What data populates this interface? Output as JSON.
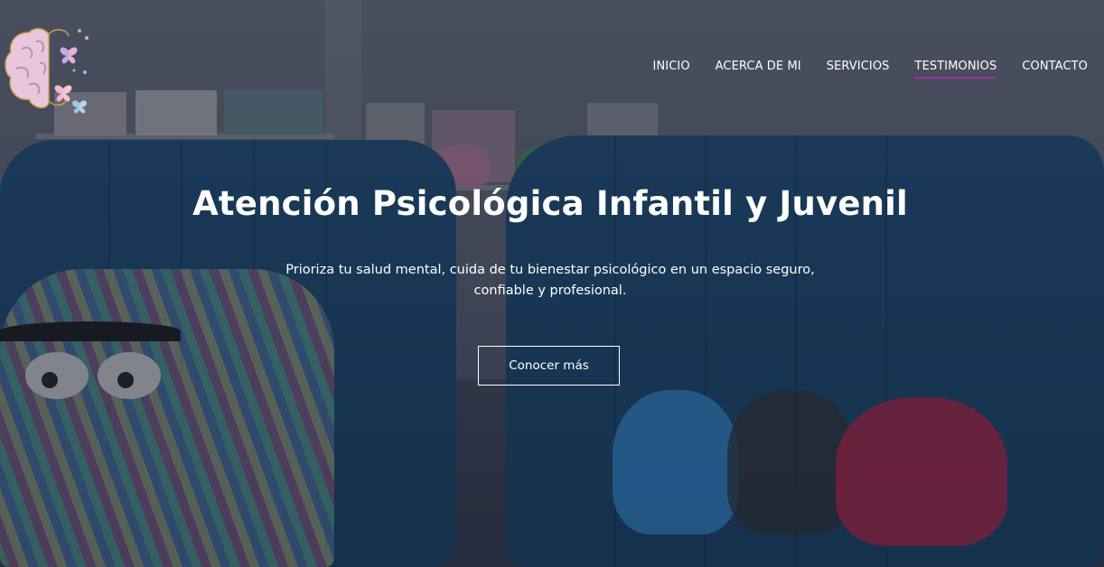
{
  "nav": {
    "items": [
      {
        "label": "INICIO",
        "active": false
      },
      {
        "label": "ACERCA DE MI",
        "active": false
      },
      {
        "label": "SERVICIOS",
        "active": false
      },
      {
        "label": "TESTIMONIOS",
        "active": true
      },
      {
        "label": "CONTACTO",
        "active": false
      }
    ]
  },
  "hero": {
    "title": "Atención Psicológica Infantil y Juvenil",
    "subtitle_line1": "Prioriza tu salud mental, cuida de tu bienestar psicológico en un espacio seguro,",
    "subtitle_line2": "confiable y profesional.",
    "cta_label": "Conocer más"
  },
  "colors": {
    "nav_active_underline": "#a12ca8",
    "text": "#ffffff"
  },
  "icons": {
    "logo": "brain-butterflies-icon"
  }
}
